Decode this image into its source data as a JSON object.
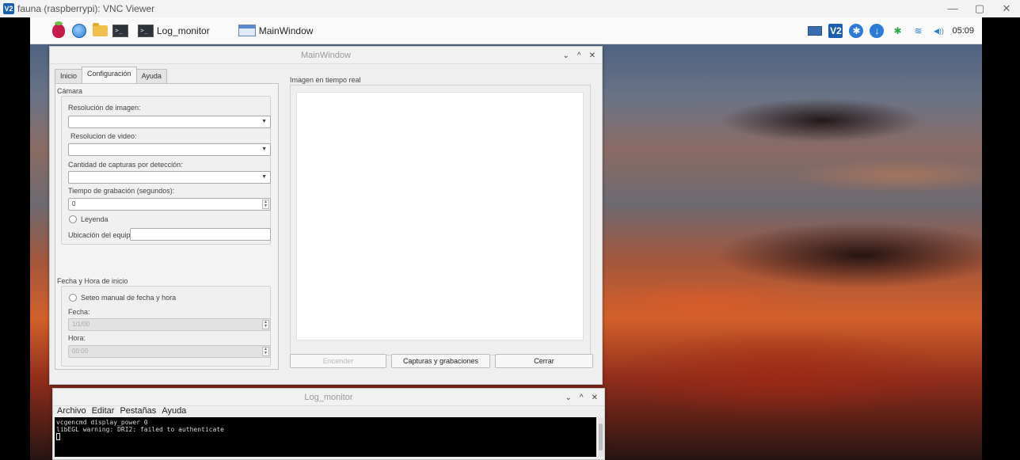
{
  "vnc": {
    "logo": "V2",
    "title": "fauna (raspberrypi): VNC Viewer",
    "controls": [
      "—",
      "▢",
      "✕"
    ]
  },
  "taskbar": {
    "terminal_glyph": ">_",
    "tasks": [
      {
        "label": "Log_monitor",
        "icon": "terminal-icon"
      },
      {
        "label": "MainWindow",
        "icon": "window-icon"
      }
    ],
    "tray": {
      "vnc_badge": "V2",
      "bluetooth_glyph": "✱",
      "wifi_glyph": "≋",
      "volume_glyph": "◀))",
      "clock": "05:09"
    }
  },
  "main_window": {
    "title": "MainWindow",
    "controls": [
      "⌄",
      "^",
      "✕"
    ],
    "tabs": [
      "Inicio",
      "Configuración",
      "Ayuda"
    ],
    "active_tab": "Configuración",
    "camera_section": {
      "heading": "Cámara",
      "image_resolution_label": "Resolución de imagen:",
      "image_resolution_value": "",
      "video_resolution_label": "Resolucion de video:",
      "video_resolution_value": "",
      "captures_label": "Cantidad de capturas por detección:",
      "captures_value": "",
      "record_time_label": "Tiempo de grabación (segundos):",
      "record_time_value": "0",
      "legend_label": "Leyenda",
      "location_label": "Ubicación del equipo:",
      "location_value": ""
    },
    "datetime_section": {
      "heading": "Fecha y Hora de inicio",
      "manual_label": "Seteo manual de fecha y hora",
      "date_label": "Fecha:",
      "date_value": "1/1/00",
      "time_label": "Hora:",
      "time_value": "00:00"
    },
    "preview_label": "Imagen en tiempo real",
    "buttons": {
      "start": "Encender",
      "captures": "Capturas y grabaciones",
      "close": "Cerrar"
    }
  },
  "log_window": {
    "title": "Log_monitor",
    "controls": [
      "⌄",
      "^",
      "✕"
    ],
    "menu": [
      "Archivo",
      "Editar",
      "Pestañas",
      "Ayuda"
    ],
    "lines": [
      "vcgencmd display_power 0",
      "libEGL warning: DRI2: failed to authenticate"
    ]
  }
}
